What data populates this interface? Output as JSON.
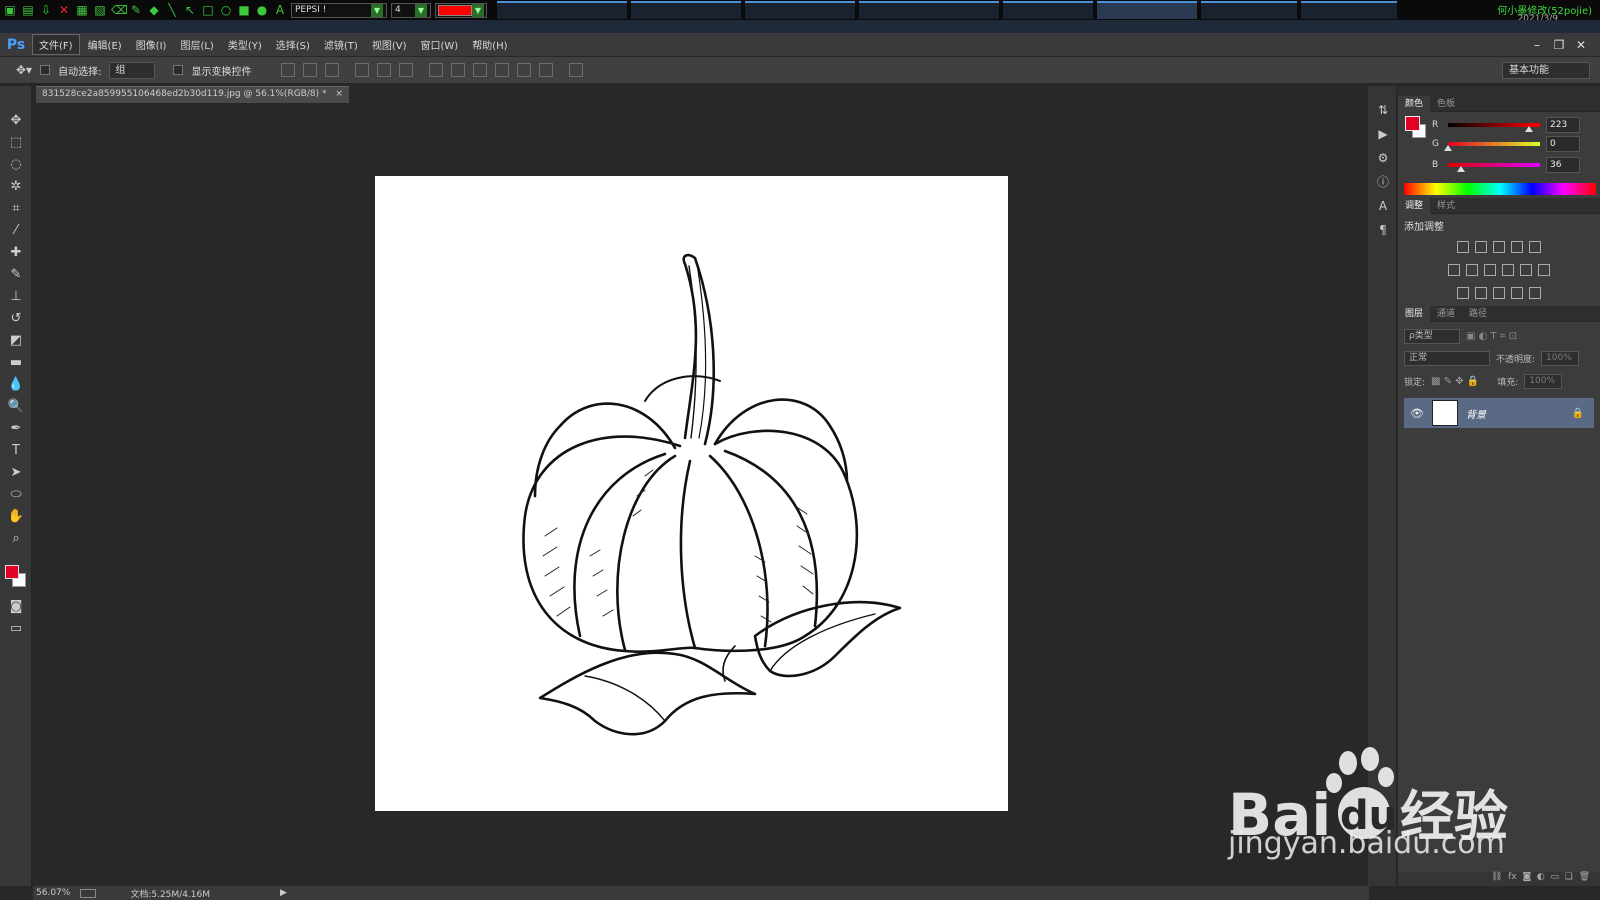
{
  "topbar": {
    "font_select": "PEPSI !",
    "size_select": "4",
    "pen_color": "#ff0000",
    "owner_text": "何小墨修改(52pojie)",
    "date_text": "2021/3/9"
  },
  "app": {
    "logo": "Ps",
    "menus": [
      "文件(F)",
      "编辑(E)",
      "图像(I)",
      "图层(L)",
      "类型(Y)",
      "选择(S)",
      "滤镜(T)",
      "视图(V)",
      "窗口(W)",
      "帮助(H)"
    ]
  },
  "options": {
    "auto_select_label": "自动选择:",
    "auto_select_value": "组",
    "show_transform_label": "显示变换控件",
    "workspace": "基本功能"
  },
  "document": {
    "tab_title": "831528ce2a859955106468ed2b30d119.jpg @ 56.1%(RGB/8) *",
    "close_glyph": "×",
    "canvas_bg": "#ffffff"
  },
  "color_panel": {
    "tabs": [
      "颜色",
      "色板"
    ],
    "fg_color": "#df0024",
    "bg_color": "#ffffff",
    "r_label": "R",
    "g_label": "G",
    "b_label": "B",
    "r": "223",
    "g": "0",
    "b": "36",
    "r_frac": 0.875,
    "g_frac": 0.0,
    "b_frac": 0.141
  },
  "adjust_panel": {
    "tabs": [
      "调整",
      "样式"
    ],
    "title": "添加调整"
  },
  "layers_panel": {
    "tabs": [
      "图层",
      "通道",
      "路径"
    ],
    "filter": "ρ类型",
    "blend_mode": "正常",
    "opacity_label": "不透明度:",
    "opacity_value": "100%",
    "lock_label": "锁定:",
    "fill_label": "填充:",
    "fill_value": "100%",
    "layer_name": "背景"
  },
  "status": {
    "zoom": "56.07%",
    "doc_size": "文档:5.25M/4.16M"
  },
  "watermark": {
    "brand_a": "Bai",
    "brand_b": "du",
    "brand_c": "经验",
    "url": "jingyan.baidu.com"
  }
}
